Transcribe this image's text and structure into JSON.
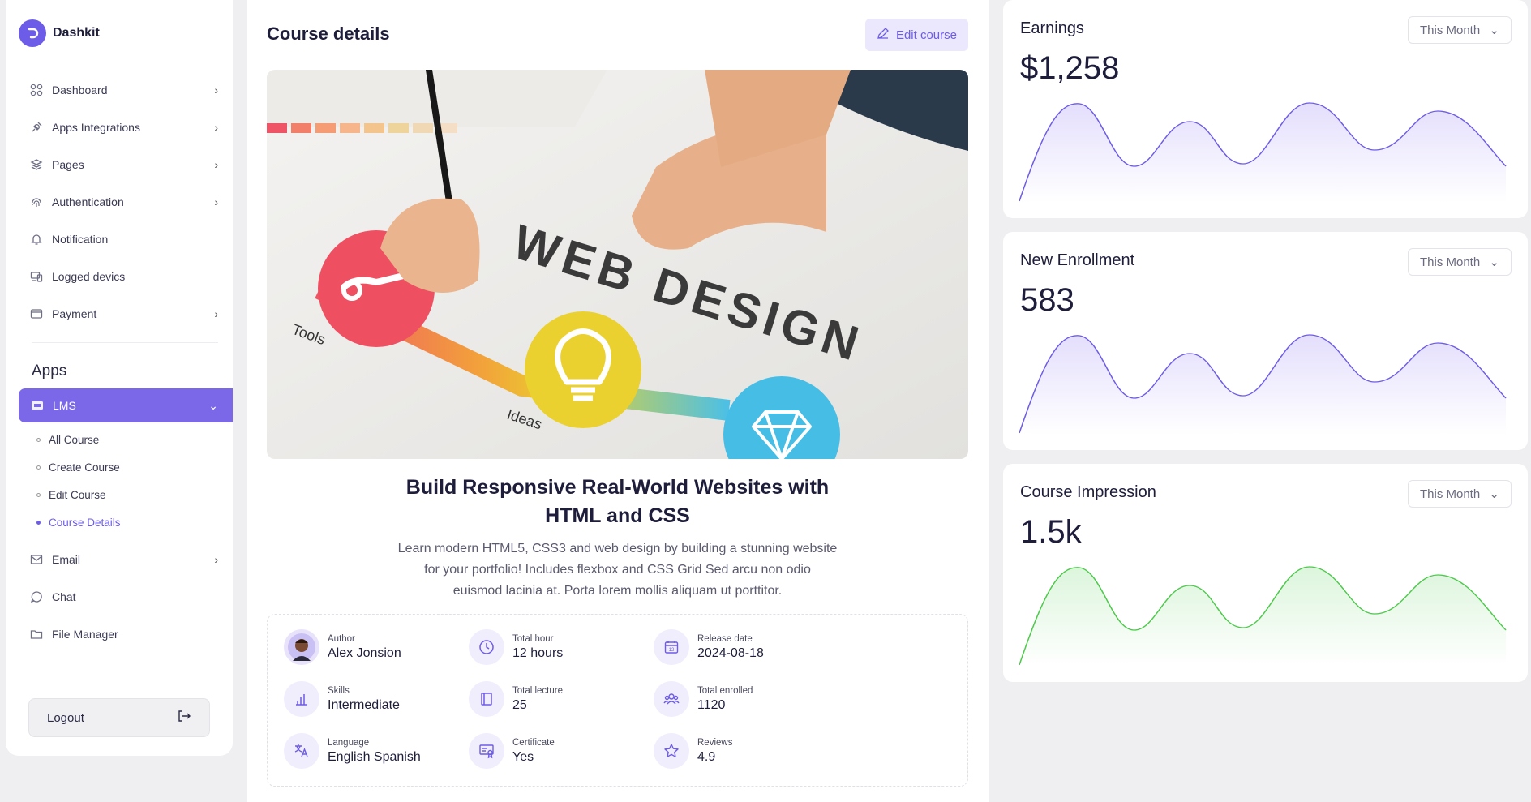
{
  "brand": {
    "name": "Dashkit"
  },
  "sidebar": {
    "items": [
      {
        "label": "Dashboard",
        "icon": "grid-icon",
        "has_arrow": true
      },
      {
        "label": "Apps Integrations",
        "icon": "plug-icon",
        "has_arrow": true
      },
      {
        "label": "Pages",
        "icon": "layers-icon",
        "has_arrow": true
      },
      {
        "label": "Authentication",
        "icon": "fingerprint-icon",
        "has_arrow": true
      },
      {
        "label": "Notification",
        "icon": "bell-icon",
        "has_arrow": false
      },
      {
        "label": "Logged devics",
        "icon": "devices-icon",
        "has_arrow": false
      },
      {
        "label": "Payment",
        "icon": "wallet-icon",
        "has_arrow": true
      }
    ],
    "apps_title": "Apps",
    "lms": {
      "label": "LMS",
      "icon": "lms-icon"
    },
    "lms_sub": [
      {
        "label": "All Course"
      },
      {
        "label": "Create Course"
      },
      {
        "label": "Edit Course"
      },
      {
        "label": "Course Details"
      }
    ],
    "apps_items": [
      {
        "label": "Email",
        "icon": "mail-icon",
        "has_arrow": true
      },
      {
        "label": "Chat",
        "icon": "chat-icon",
        "has_arrow": false
      },
      {
        "label": "File Manager",
        "icon": "folder-icon",
        "has_arrow": false
      }
    ],
    "logout_label": "Logout"
  },
  "main": {
    "title": "Course details",
    "edit_label": "Edit course",
    "hero": {
      "words": "WEB DESIGN",
      "tools": "Tools",
      "ideas": "Ideas"
    },
    "course_title_line1": "Build Responsive Real-World Websites with",
    "course_title_line2": "HTML and CSS",
    "desc_line1": "Learn modern HTML5, CSS3 and web design by building a stunning website",
    "desc_line2": "for your portfolio! Includes flexbox and CSS Grid Sed arcu non odio",
    "desc_line3": "euismod lacinia at. Porta lorem mollis aliquam ut porttitor.",
    "info": {
      "author": {
        "label": "Author",
        "value": "Alex Jonsion"
      },
      "hours": {
        "label": "Total hour",
        "value": "12 hours"
      },
      "release": {
        "label": "Release date",
        "value": "2024-08-18",
        "icon_text": "12"
      },
      "skills": {
        "label": "Skills",
        "value": "Intermediate"
      },
      "lecture": {
        "label": "Total lecture",
        "value": "25"
      },
      "enrolled": {
        "label": "Total enrolled",
        "value": "1120"
      },
      "language": {
        "label": "Language",
        "value": "English Spanish"
      },
      "certificate": {
        "label": "Certificate",
        "value": "Yes"
      },
      "reviews": {
        "label": "Reviews",
        "value": "4.9"
      }
    }
  },
  "cards": [
    {
      "title": "Earnings",
      "period": "This Month",
      "value": "$1,258",
      "color": "#6c5ce7",
      "fill": "#e4defc"
    },
    {
      "title": "New Enrollment",
      "period": "This Month",
      "value": "583",
      "color": "#6c5ce7",
      "fill": "#e4defc"
    },
    {
      "title": "Course Impression",
      "period": "This Month",
      "value": "1.5k",
      "color": "#4cc94a",
      "fill": "#dcf5dc"
    }
  ],
  "colors": {
    "accent": "#7b68e8",
    "brand": "#6c5ce7"
  }
}
